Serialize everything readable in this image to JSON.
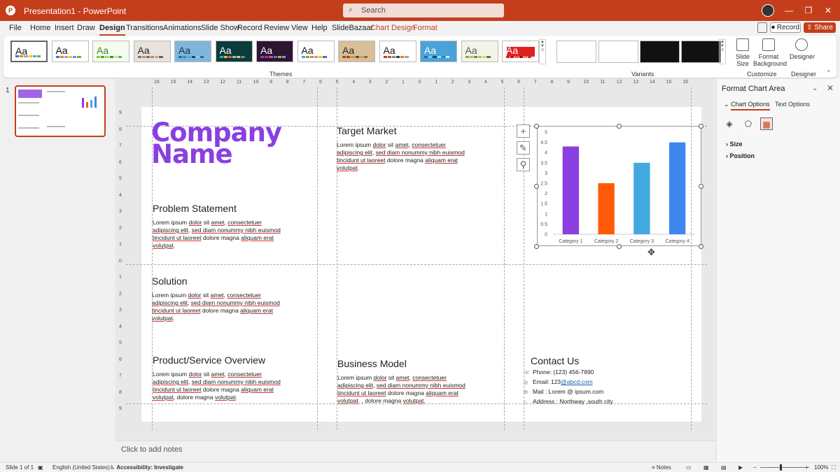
{
  "app": {
    "title": "Presentation1 - PowerPoint",
    "search_placeholder": "Search",
    "icon_letter": "P"
  },
  "window_controls": {
    "minimize": "—",
    "restore": "❐",
    "close": "✕"
  },
  "menu": {
    "tabs": [
      "File",
      "Home",
      "Insert",
      "Draw",
      "Design",
      "Transitions",
      "Animations",
      "Slide Show",
      "Record",
      "Review",
      "View",
      "Help",
      "SlideBazaar",
      "Chart Design",
      "Format"
    ],
    "active_tab": "Design",
    "record_label": "Record",
    "share_label": "Share"
  },
  "ribbon": {
    "themes_label": "Themes",
    "variants_label": "Variants",
    "customize_label": "Customize",
    "designer_group_label": "Designer",
    "theme_thumb_text": "Aa",
    "tools": {
      "slide_size": "Slide Size",
      "format_background": "Format Background",
      "designer": "Designer"
    }
  },
  "slides_panel": {
    "slide_number": "1"
  },
  "slide": {
    "company_line1": "Company",
    "company_line2": "Name",
    "sections": {
      "problem": {
        "heading": "Problem Statement",
        "body_a": "Lorem ipsum ",
        "body_b": "dolor",
        "body_c": " sit ",
        "body_d": "amet",
        "body_e": ", ",
        "body_f": "consectetuer adipiscing elit",
        "body_g": ", ",
        "body_h": "sed diam nonummy nibh euismod tincidunt ut laoreet",
        "body_i": " dolore magna ",
        "body_j": "aliquam erat volutpat",
        "body_k": "."
      },
      "solution": {
        "heading": "Solution",
        "body_a": "Lorem ipsum ",
        "body_b": "dolor",
        "body_c": " sit ",
        "body_d": "amet",
        "body_e": ", ",
        "body_f": "consectetuer adipiscing elit",
        "body_g": ", ",
        "body_h": "sed diam nonummy nibh euismod tincidunt ut laoreet",
        "body_i": " dolore magna ",
        "body_j": "aliquam erat volutpat",
        "body_k": "."
      },
      "product": {
        "heading": "Product/Service Overview",
        "body_a": "Lorem ipsum ",
        "body_b": "dolor",
        "body_c": " sit ",
        "body_d": "amet",
        "body_e": ", ",
        "body_f": "consectetuer adipiscing elit",
        "body_g": ", ",
        "body_h": "sed diam nonummy nibh euismod tincidunt ut laoreet",
        "body_i": " dolore magna ",
        "body_j": "aliquam erat volutpat",
        "body_k": ", dolore magna ",
        "body_l": "volutpat",
        "body_m": "."
      },
      "target": {
        "heading": "Target Market",
        "body_a": "Lorem ipsum ",
        "body_b": "dolor",
        "body_c": " sit ",
        "body_d": "amet",
        "body_e": ", ",
        "body_f": "consectetuer adipiscing elit",
        "body_g": ", ",
        "body_h": "sed diam nonummy nibh euismod tincidunt ut laoreet",
        "body_i": " dolore magna ",
        "body_j": "aliquam erat volutpat",
        "body_k": "."
      },
      "business": {
        "heading": "Business Model",
        "body_a": "Lorem ipsum ",
        "body_b": "dolor",
        "body_c": " sit ",
        "body_d": "amet",
        "body_e": ", ",
        "body_f": "consectetuer adipiscing elit",
        "body_g": ", ",
        "body_h": "sed diam nonummy nibh euismod tincidunt ut laoreet",
        "body_i": " dolore magna ",
        "body_j": "aliquam erat volutpat",
        "body_k": ". , dolore magna ",
        "body_l": "volutpat",
        "body_m": "."
      }
    },
    "contact": {
      "heading": "Contact Us",
      "phone": "Phone: (123) 456-7890",
      "email_prefix": "Email: 123",
      "email_link": "@abcd.com",
      "mail": "Mail : Lorem @ ipsum.com",
      "address": "Address : Northway ,south city"
    },
    "chart_tools": [
      "+",
      "✎",
      "⚲"
    ]
  },
  "chart_data": {
    "type": "bar",
    "categories": [
      "Category 1",
      "Category 2",
      "Category 3",
      "Category 4"
    ],
    "values": [
      4.3,
      2.5,
      3.5,
      4.5
    ],
    "colors": [
      "#8a3fe0",
      "#ff5a0a",
      "#41a9e0",
      "#3e86f0"
    ],
    "ylim": [
      0,
      5
    ],
    "yticks": [
      "0",
      "0.5",
      "1",
      "1.5",
      "2",
      "2.5",
      "3",
      "3.5",
      "4",
      "4.5",
      "5"
    ],
    "grid": false
  },
  "notes_placeholder": "Click to add notes",
  "format_pane": {
    "title": "Format Chart Area",
    "tab_chart_options": "Chart Options",
    "tab_text_options": "Text Options",
    "section_size": "Size",
    "section_position": "Position"
  },
  "statusbar": {
    "slide_info": "Slide 1 of 1",
    "language": "English (United States)",
    "accessibility": "Accessibility: Investigate",
    "notes": "Notes",
    "zoom": "100%"
  },
  "colors": {
    "accent": "#c43e1c",
    "company_purple": "#8a3fe0"
  }
}
